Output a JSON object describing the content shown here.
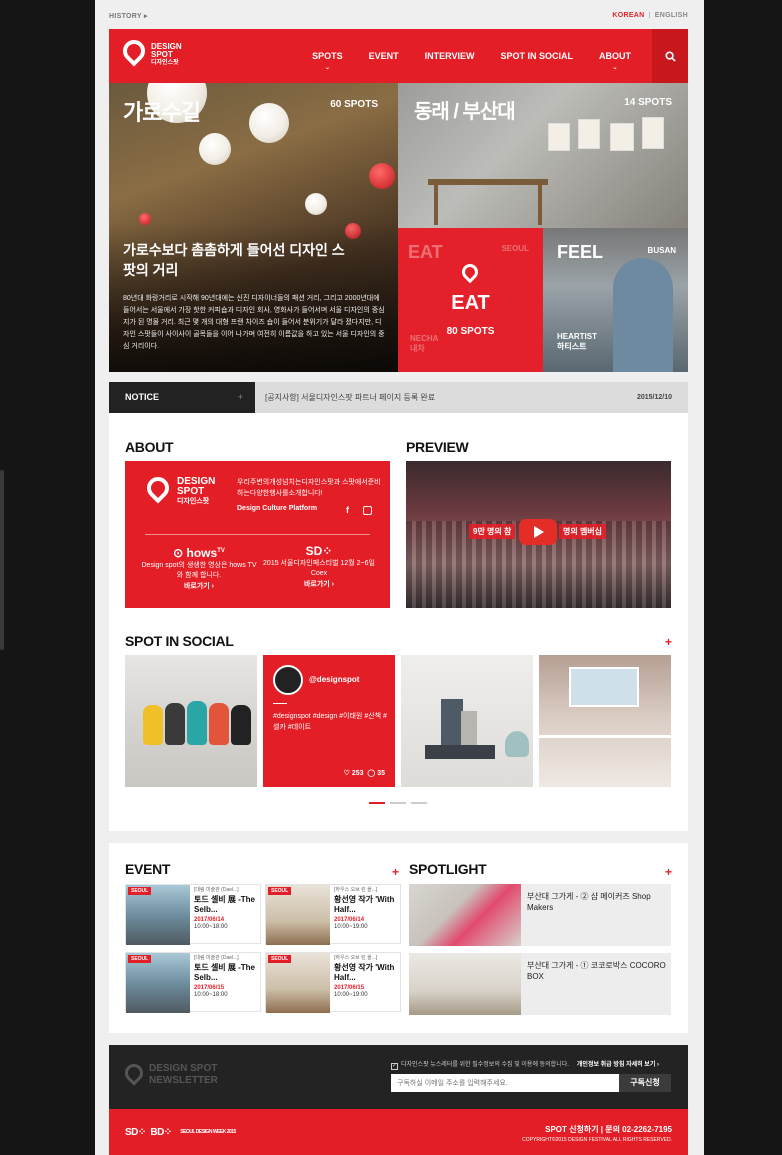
{
  "topbar": {
    "history": "HISTORY ▸",
    "lang_korean": "KOREAN",
    "lang_sep": "|",
    "lang_english": "ENGLISH"
  },
  "brand": {
    "name_line1": "DESIGN",
    "name_line2": "SPOT",
    "name_line3": "디자인스팟",
    "accent": "#e41e26"
  },
  "nav": {
    "items": [
      {
        "label": "SPOTS",
        "caret": "⌄"
      },
      {
        "label": "EVENT"
      },
      {
        "label": "INTERVIEW"
      },
      {
        "label": "SPOT IN SOCIAL"
      },
      {
        "label": "ABOUT",
        "caret": "⌄"
      }
    ],
    "search_icon": "search-icon"
  },
  "hero": {
    "left": {
      "title": "가로수길",
      "count": "60 SPOTS",
      "headline": "가로수보다 촘촘하게 들어선 디자인 스팟의 거리",
      "desc": "80년대 화랑거리로 시작해 90년대에는 신진 디자이너들의 패션 거리, 그리고 2000년대에 들어서는 서울에서 가장 핫한 커피숍과 디자인 회사, 영화사가 들어서며 서울 디자인의 중심지가 된 명물 거리. 최근 몇 개의 대형 프랜 차이즈 숍이 들어서 분위기가 달라 졌다지만, 디자인 스팟들이 사이사이 골목들을 이어 나가며 여전히 이름값을 하고 있는 서울 디자인의 중심 거리이다."
    },
    "right_top": {
      "title": "동래 / 부산대",
      "count": "14 SPOTS"
    },
    "eat": {
      "bg_word": "EAT",
      "city": "SEOUL",
      "title": "EAT",
      "count": "80 SPOTS",
      "shop_en": "NECHA",
      "shop_ko": "내차"
    },
    "feel": {
      "title": "FEEL",
      "city": "BUSAN",
      "shop_en": "HEARTIST",
      "shop_ko": "하티스트"
    }
  },
  "notice": {
    "label": "NOTICE",
    "plus": "+",
    "message": "[공지사항] 서울디자인스팟 파트너 페이지 등록 완료",
    "date": "2015/12/10"
  },
  "about": {
    "title": "ABOUT",
    "intro": "우리주변의개성넘치는디자인스팟과 스팟에서준비하는다양한행사를소개합니다!",
    "culture": "Design Culture Platform",
    "facebook": "f",
    "col1": {
      "brand": "hows",
      "sup": "TV",
      "desc": "Design spot의 생생한 영상은 hows TV와 함께 합니다.",
      "more": "바로가기 ›"
    },
    "col2": {
      "brand": "SD",
      "desc": "2015 서울디자인페스티벌 12월 2~6일 Coex",
      "more": "바로가기 ›"
    }
  },
  "preview": {
    "title": "PREVIEW",
    "caption_left": "9만 명의 참",
    "caption_right": "명의 멤버십"
  },
  "social": {
    "title": "SPOT IN SOCIAL",
    "plus": "+",
    "handle": "@designspot",
    "tags": "#designspot #design #이태원 #산책 #셀카 #데이트",
    "likes": "♡ 253",
    "comments": "◯ 35"
  },
  "event": {
    "title": "EVENT",
    "plus": "+",
    "items": [
      {
        "badge": "SEOUL",
        "venue": "[대림 미술관 (Dael...]",
        "name": "토드 셀비 展 -The Selb...",
        "date": "2017/06/14",
        "time": "10:00~18:00"
      },
      {
        "badge": "SEOUL",
        "venue": "[하우스 오브 린 을...]",
        "name": "황선영 작가 'With Half...",
        "date": "2017/06/14",
        "time": "10:00~19:00"
      },
      {
        "badge": "SEOUL",
        "venue": "[대림 미술관 (Dael...]",
        "name": "토드 셀비 展 -The Selb...",
        "date": "2017/06/15",
        "time": "10:00~18:00"
      },
      {
        "badge": "SEOUL",
        "venue": "[하우스 오브 린 을...]",
        "name": "황선영 작가 'With Half...",
        "date": "2017/06/15",
        "time": "10:00~19:00"
      }
    ]
  },
  "spotlight": {
    "title": "SPOTLIGHT",
    "plus": "+",
    "items": [
      {
        "text": "부산대 그가게 - ② 샵 메이커즈 Shop Makers"
      },
      {
        "text": "부산대 그가게 - ① 코코로박스 COCORO BOX"
      }
    ]
  },
  "newsletter": {
    "line1": "DESIGN SPOT",
    "line2": "NEWSLETTER",
    "agree": "디자인스팟 뉴스레터를 위한 필수정보의 수집 및 이용에 동의합니다.",
    "policy": "개인정보 취급 방침 자세히 보기 ›",
    "placeholder": "구독하실 이메일 주소를 입력해주세요.",
    "subscribe": "구독신청"
  },
  "footer": {
    "logo1": "SD",
    "logo2": "BD",
    "logo3": "SEOUL DESIGN WEEK 2015",
    "links": "SPOT 신청하기   |   문의  02-2262-7195",
    "copyright": "COPYRIGHT©2015 DESIGN FESTIVAL ALL RIGHTS RESERVED."
  }
}
